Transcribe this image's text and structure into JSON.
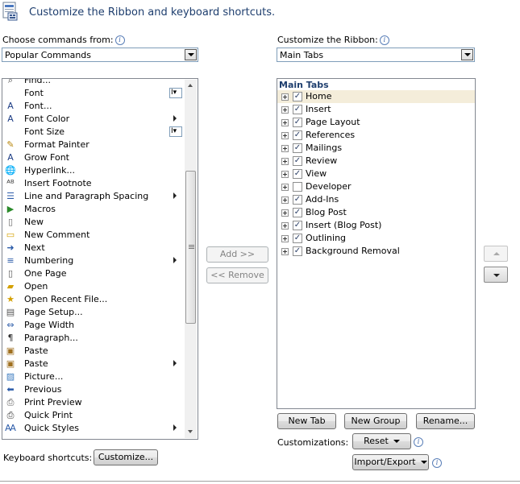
{
  "header": {
    "title": "Customize the Ribbon and keyboard shortcuts."
  },
  "commands_panel": {
    "label": "Choose commands from:",
    "dropdown_value": "Popular Commands",
    "items": [
      {
        "label": "Find...",
        "icon": "find-icon",
        "submenu": false,
        "selector": false
      },
      {
        "label": "Font",
        "icon": "",
        "submenu": false,
        "selector": true
      },
      {
        "label": "Font...",
        "icon": "font-dialog-icon",
        "submenu": false,
        "selector": false
      },
      {
        "label": "Font Color",
        "icon": "font-color-icon",
        "submenu": true,
        "selector": false
      },
      {
        "label": "Font Size",
        "icon": "",
        "submenu": false,
        "selector": true
      },
      {
        "label": "Format Painter",
        "icon": "format-painter-icon",
        "submenu": false,
        "selector": false
      },
      {
        "label": "Grow Font",
        "icon": "grow-font-icon",
        "submenu": false,
        "selector": false
      },
      {
        "label": "Hyperlink...",
        "icon": "hyperlink-icon",
        "submenu": false,
        "selector": false
      },
      {
        "label": "Insert Footnote",
        "icon": "insert-footnote-icon",
        "submenu": false,
        "selector": false
      },
      {
        "label": "Line and Paragraph Spacing",
        "icon": "line-spacing-icon",
        "submenu": true,
        "selector": false
      },
      {
        "label": "Macros",
        "icon": "macros-icon",
        "submenu": false,
        "selector": false
      },
      {
        "label": "New",
        "icon": "new-document-icon",
        "submenu": false,
        "selector": false
      },
      {
        "label": "New Comment",
        "icon": "new-comment-icon",
        "submenu": false,
        "selector": false
      },
      {
        "label": "Next",
        "icon": "next-icon",
        "submenu": false,
        "selector": false
      },
      {
        "label": "Numbering",
        "icon": "numbering-icon",
        "submenu": true,
        "selector": false
      },
      {
        "label": "One Page",
        "icon": "one-page-icon",
        "submenu": false,
        "selector": false
      },
      {
        "label": "Open",
        "icon": "open-folder-icon",
        "submenu": false,
        "selector": false
      },
      {
        "label": "Open Recent File...",
        "icon": "open-recent-icon",
        "submenu": false,
        "selector": false
      },
      {
        "label": "Page Setup...",
        "icon": "page-setup-icon",
        "submenu": false,
        "selector": false
      },
      {
        "label": "Page Width",
        "icon": "page-width-icon",
        "submenu": false,
        "selector": false
      },
      {
        "label": "Paragraph...",
        "icon": "paragraph-icon",
        "submenu": false,
        "selector": false
      },
      {
        "label": "Paste",
        "icon": "paste-icon",
        "submenu": false,
        "selector": false
      },
      {
        "label": "Paste",
        "icon": "paste-menu-icon",
        "submenu": true,
        "selector": false
      },
      {
        "label": "Picture...",
        "icon": "picture-icon",
        "submenu": false,
        "selector": false
      },
      {
        "label": "Previous",
        "icon": "previous-icon",
        "submenu": false,
        "selector": false
      },
      {
        "label": "Print Preview",
        "icon": "print-preview-icon",
        "submenu": false,
        "selector": false
      },
      {
        "label": "Quick Print",
        "icon": "quick-print-icon",
        "submenu": false,
        "selector": false
      },
      {
        "label": "Quick Styles",
        "icon": "quick-styles-icon",
        "submenu": true,
        "selector": false
      }
    ],
    "keyboard_shortcuts_label": "Keyboard shortcuts:",
    "customize_button": "Customize..."
  },
  "middle": {
    "add_button": "Add >>",
    "remove_button": "<< Remove"
  },
  "ribbon_panel": {
    "label": "Customize the Ribbon:",
    "dropdown_value": "Main Tabs",
    "tree_header": "Main Tabs",
    "tabs": [
      {
        "label": "Home",
        "checked": true,
        "selected": true
      },
      {
        "label": "Insert",
        "checked": true,
        "selected": false
      },
      {
        "label": "Page Layout",
        "checked": true,
        "selected": false
      },
      {
        "label": "References",
        "checked": true,
        "selected": false
      },
      {
        "label": "Mailings",
        "checked": true,
        "selected": false
      },
      {
        "label": "Review",
        "checked": true,
        "selected": false
      },
      {
        "label": "View",
        "checked": true,
        "selected": false
      },
      {
        "label": "Developer",
        "checked": false,
        "selected": false
      },
      {
        "label": "Add-Ins",
        "checked": true,
        "selected": false
      },
      {
        "label": "Blog Post",
        "checked": true,
        "selected": false
      },
      {
        "label": "Insert (Blog Post)",
        "checked": true,
        "selected": false
      },
      {
        "label": "Outlining",
        "checked": true,
        "selected": false
      },
      {
        "label": "Background Removal",
        "checked": true,
        "selected": false
      }
    ],
    "new_tab_button": "New Tab",
    "new_group_button": "New Group",
    "rename_button": "Rename...",
    "customizations_label": "Customizations:",
    "reset_button": "Reset",
    "import_export_button": "Import/Export"
  },
  "colors": {
    "accent_title": "#1e3e6e",
    "selection": "#f4edda",
    "tree_header": "#1e3e6e"
  }
}
